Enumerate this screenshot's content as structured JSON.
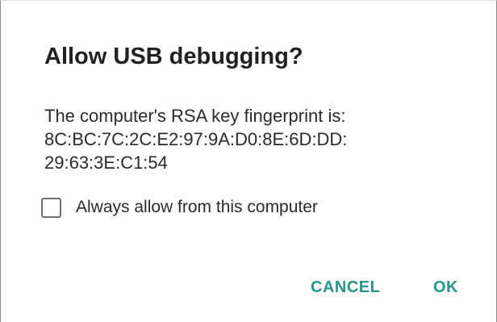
{
  "dialog": {
    "title": "Allow USB debugging?",
    "message_line1": "The computer's RSA key fingerprint is:",
    "message_line2": "8C:BC:7C:2C:E2:97:9A:D0:8E:6D:DD:",
    "message_line3": "29:63:3E:C1:54",
    "checkbox_label": "Always allow from this computer",
    "checkbox_checked": false,
    "cancel_label": "CANCEL",
    "ok_label": "OK",
    "accent_color": "#26958b"
  }
}
